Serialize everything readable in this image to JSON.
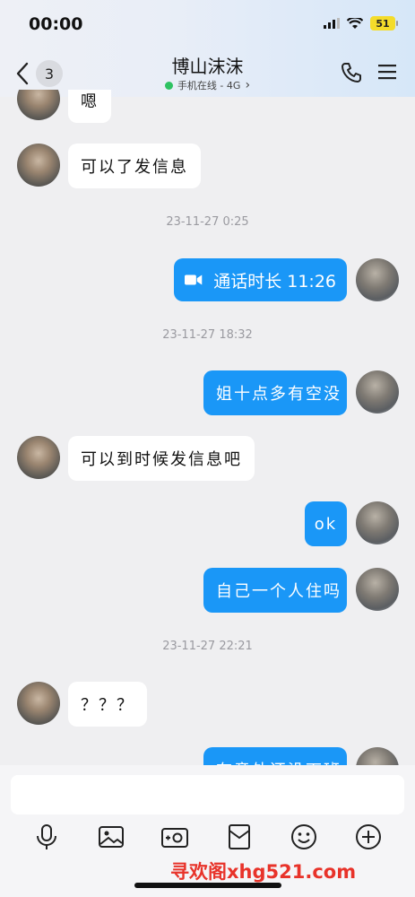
{
  "status": {
    "time": "00:00",
    "battery": "51"
  },
  "header": {
    "unread_count": "3",
    "title": "博山沫沫",
    "subtitle": "手机在线 - 4G",
    "subtitle_chevron": "›"
  },
  "messages": {
    "m0": "嗯",
    "m1": "可以了发信息",
    "t1": "23-11-27 0:25",
    "call": "通话时长 11:26",
    "t2": "23-11-27 18:32",
    "m3": "姐十点多有空没",
    "m4": "可以到时候发信息吧",
    "m5": "ok",
    "m6": "自己一个人住吗",
    "t3": "23-11-27 22:21",
    "m7": "？？？",
    "m8": "有意外还没下班"
  },
  "toolbar": {
    "icons": [
      "microphone-icon",
      "image-icon",
      "camera-icon",
      "red-packet-icon",
      "emoji-icon",
      "plus-icon"
    ]
  },
  "watermark": "寻欢阁xhg521.com",
  "colors": {
    "accent": "#1a97f7",
    "online": "#2ec262",
    "watermark": "#e8332a"
  }
}
